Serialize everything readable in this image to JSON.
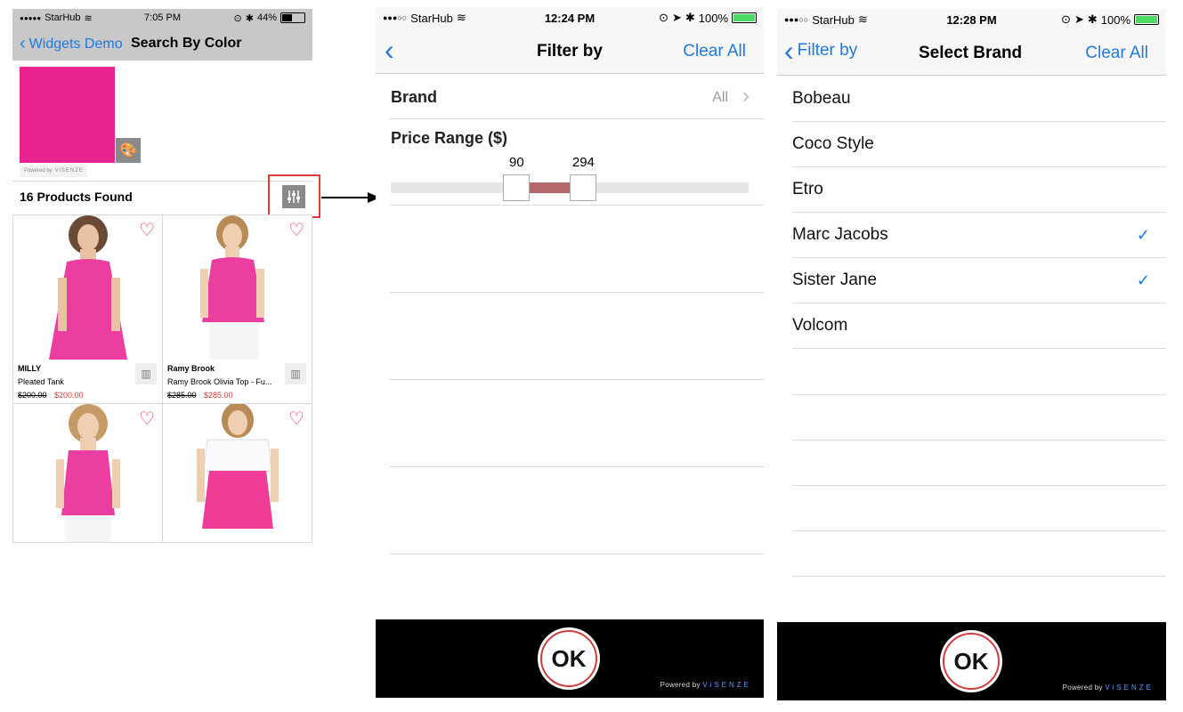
{
  "panel1": {
    "status": {
      "carrier": "StarHub",
      "time": "7:05 PM",
      "battery": "44%",
      "signal": "●●●●●"
    },
    "nav": {
      "back": "Widgets Demo",
      "title": "Search By Color"
    },
    "color_swatch": "#e8228f",
    "powered_by": "Powered by",
    "powered_brand": "ViSENZE",
    "results": "16 Products Found",
    "products": [
      {
        "brand": "MILLY",
        "name": "Pleated Tank",
        "old_price": "$200.00",
        "price": "$200.00"
      },
      {
        "brand": "Ramy Brook",
        "name": "Ramy Brook Olivia Top - Fu...",
        "old_price": "$285.00",
        "price": "$285.00"
      },
      {
        "brand": "",
        "name": "",
        "old_price": "",
        "price": ""
      },
      {
        "brand": "",
        "name": "",
        "old_price": "",
        "price": ""
      }
    ]
  },
  "panel2": {
    "status": {
      "carrier": "StarHub",
      "time": "12:24 PM",
      "battery": "100%",
      "signal": "●●●○○"
    },
    "nav": {
      "title": "Filter by",
      "clear": "Clear All"
    },
    "brand": {
      "label": "Brand",
      "value": "All"
    },
    "price": {
      "label": "Price Range ($)",
      "min_label": "90",
      "max_label": "294",
      "range_min": 0,
      "range_max": 500,
      "min_value": 90,
      "max_value": 294
    },
    "ok": "OK",
    "powered_by": "Powered by",
    "powered_brand": "ViSENZE"
  },
  "panel3": {
    "status": {
      "carrier": "StarHub",
      "time": "12:28 PM",
      "battery": "100%",
      "signal": "●●●○○"
    },
    "nav": {
      "back": "Filter by",
      "title": "Select Brand",
      "clear": "Clear All"
    },
    "brands": [
      {
        "name": "Bobeau",
        "checked": false
      },
      {
        "name": "Coco Style",
        "checked": false
      },
      {
        "name": "Etro",
        "checked": false
      },
      {
        "name": "Marc Jacobs",
        "checked": true
      },
      {
        "name": "Sister Jane",
        "checked": true
      },
      {
        "name": "Volcom",
        "checked": false
      }
    ],
    "ok": "OK",
    "powered_by": "Powered by",
    "powered_brand": "ViSENZE"
  },
  "colors": {
    "accent": "#1f7ae0",
    "highlight": "#e53935",
    "range_fill": "#b5686a",
    "swatch": "#e8228f"
  }
}
